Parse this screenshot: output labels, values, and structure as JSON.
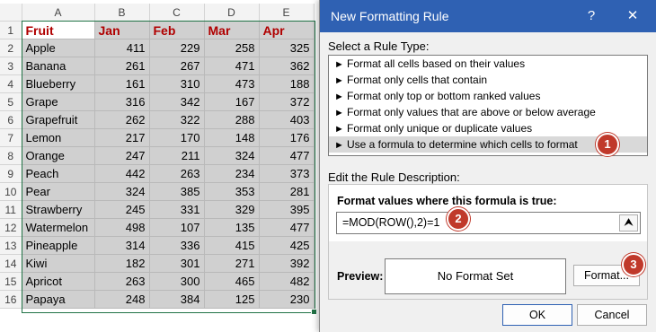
{
  "sheet": {
    "columns": [
      "A",
      "B",
      "C",
      "D",
      "E"
    ],
    "rows": [
      {
        "num": "1",
        "cells": [
          "Fruit",
          "Jan",
          "Feb",
          "Mar",
          "Apr"
        ]
      },
      {
        "num": "2",
        "cells": [
          "Apple",
          "411",
          "229",
          "258",
          "325"
        ]
      },
      {
        "num": "3",
        "cells": [
          "Banana",
          "261",
          "267",
          "471",
          "362"
        ]
      },
      {
        "num": "4",
        "cells": [
          "Blueberry",
          "161",
          "310",
          "473",
          "188"
        ]
      },
      {
        "num": "5",
        "cells": [
          "Grape",
          "316",
          "342",
          "167",
          "372"
        ]
      },
      {
        "num": "6",
        "cells": [
          "Grapefruit",
          "262",
          "322",
          "288",
          "403"
        ]
      },
      {
        "num": "7",
        "cells": [
          "Lemon",
          "217",
          "170",
          "148",
          "176"
        ]
      },
      {
        "num": "8",
        "cells": [
          "Orange",
          "247",
          "211",
          "324",
          "477"
        ]
      },
      {
        "num": "9",
        "cells": [
          "Peach",
          "442",
          "263",
          "234",
          "373"
        ]
      },
      {
        "num": "10",
        "cells": [
          "Pear",
          "324",
          "385",
          "353",
          "281"
        ]
      },
      {
        "num": "11",
        "cells": [
          "Strawberry",
          "245",
          "331",
          "329",
          "395"
        ]
      },
      {
        "num": "12",
        "cells": [
          "Watermelon",
          "498",
          "107",
          "135",
          "477"
        ]
      },
      {
        "num": "13",
        "cells": [
          "Pineapple",
          "314",
          "336",
          "415",
          "425"
        ]
      },
      {
        "num": "14",
        "cells": [
          "Kiwi",
          "182",
          "301",
          "271",
          "392"
        ]
      },
      {
        "num": "15",
        "cells": [
          "Apricot",
          "263",
          "300",
          "465",
          "482"
        ]
      },
      {
        "num": "16",
        "cells": [
          "Papaya",
          "248",
          "384",
          "125",
          "230"
        ]
      }
    ],
    "header_color": "#b00000",
    "selection_color": "#217346"
  },
  "dialog": {
    "title": "New Formatting Rule",
    "help_label": "?",
    "close_label": "✕",
    "rule_type_label": "Select a Rule Type:",
    "rule_types": [
      "Format all cells based on their values",
      "Format only cells that contain",
      "Format only top or bottom ranked values",
      "Format only values that are above or below average",
      "Format only unique or duplicate values",
      "Use a formula to determine which cells to format"
    ],
    "selected_rule_index": 5,
    "rule_arrow_icon": "►",
    "edit_label": "Edit the Rule Description:",
    "formula_label": "Format values where this formula is true:",
    "formula_value": "=MOD(ROW(),2)=1",
    "collapse_icon": "⮝",
    "preview_label": "Preview:",
    "preview_text": "No Format Set",
    "format_button": "Format...",
    "ok_button": "OK",
    "cancel_button": "Cancel",
    "title_color": "#2f61b3"
  },
  "callouts": [
    "1",
    "2",
    "3"
  ],
  "callout_color": "#c0392b"
}
